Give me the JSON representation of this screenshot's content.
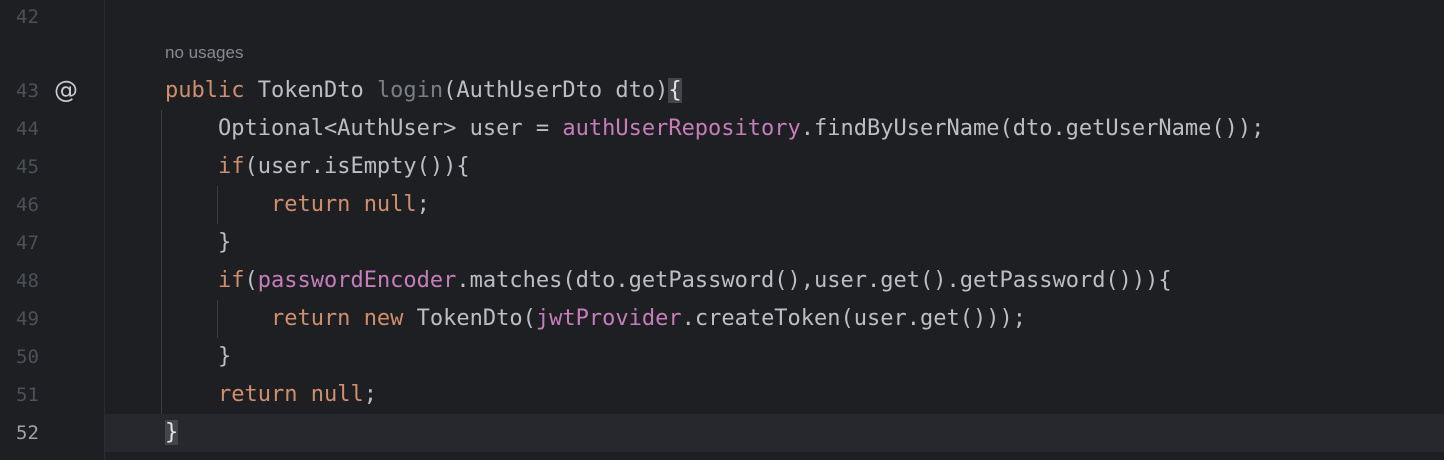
{
  "editor": {
    "theme": {
      "background": "#1e1f22",
      "keyword": "#cf8e6d",
      "field": "#c77dbb",
      "text": "#bcbec4",
      "line_number": "#4b5059",
      "current_line": "#26282e"
    },
    "line_numbers": [
      "42",
      "43",
      "44",
      "45",
      "46",
      "47",
      "48",
      "49",
      "50",
      "51",
      "52"
    ],
    "gutter_icon": {
      "symbol": "@",
      "icon": "override-annotation-icon"
    },
    "inlay_hint": "no usages",
    "lines": {
      "l43": {
        "kw_public": "public",
        "sig_a": " TokenDto ",
        "name": "login",
        "sig_b": "(AuthUserDto dto)",
        "brace": "{"
      },
      "l44": {
        "a": "    Optional<AuthUser> user = ",
        "field": "authUserRepository",
        "b": ".findByUserName(dto.getUserName());"
      },
      "l45": {
        "kw": "    if",
        "b": "(user.isEmpty()){"
      },
      "l46": {
        "kw_return": "        return ",
        "kw_null": "null",
        "b": ";"
      },
      "l47": {
        "a": "    }"
      },
      "l48": {
        "kw": "    if",
        "a": "(",
        "field": "passwordEncoder",
        "b": ".matches(dto.getPassword(),user.get().getPassword())){"
      },
      "l49": {
        "kw_return": "        return ",
        "kw_new": "new",
        "a": " TokenDto(",
        "field": "jwtProvider",
        "b": ".createToken(user.get()));"
      },
      "l50": {
        "a": "    }"
      },
      "l51": {
        "kw_return": "    return ",
        "kw_null": "null",
        "b": ";"
      },
      "l52": {
        "brace": "}"
      }
    }
  }
}
